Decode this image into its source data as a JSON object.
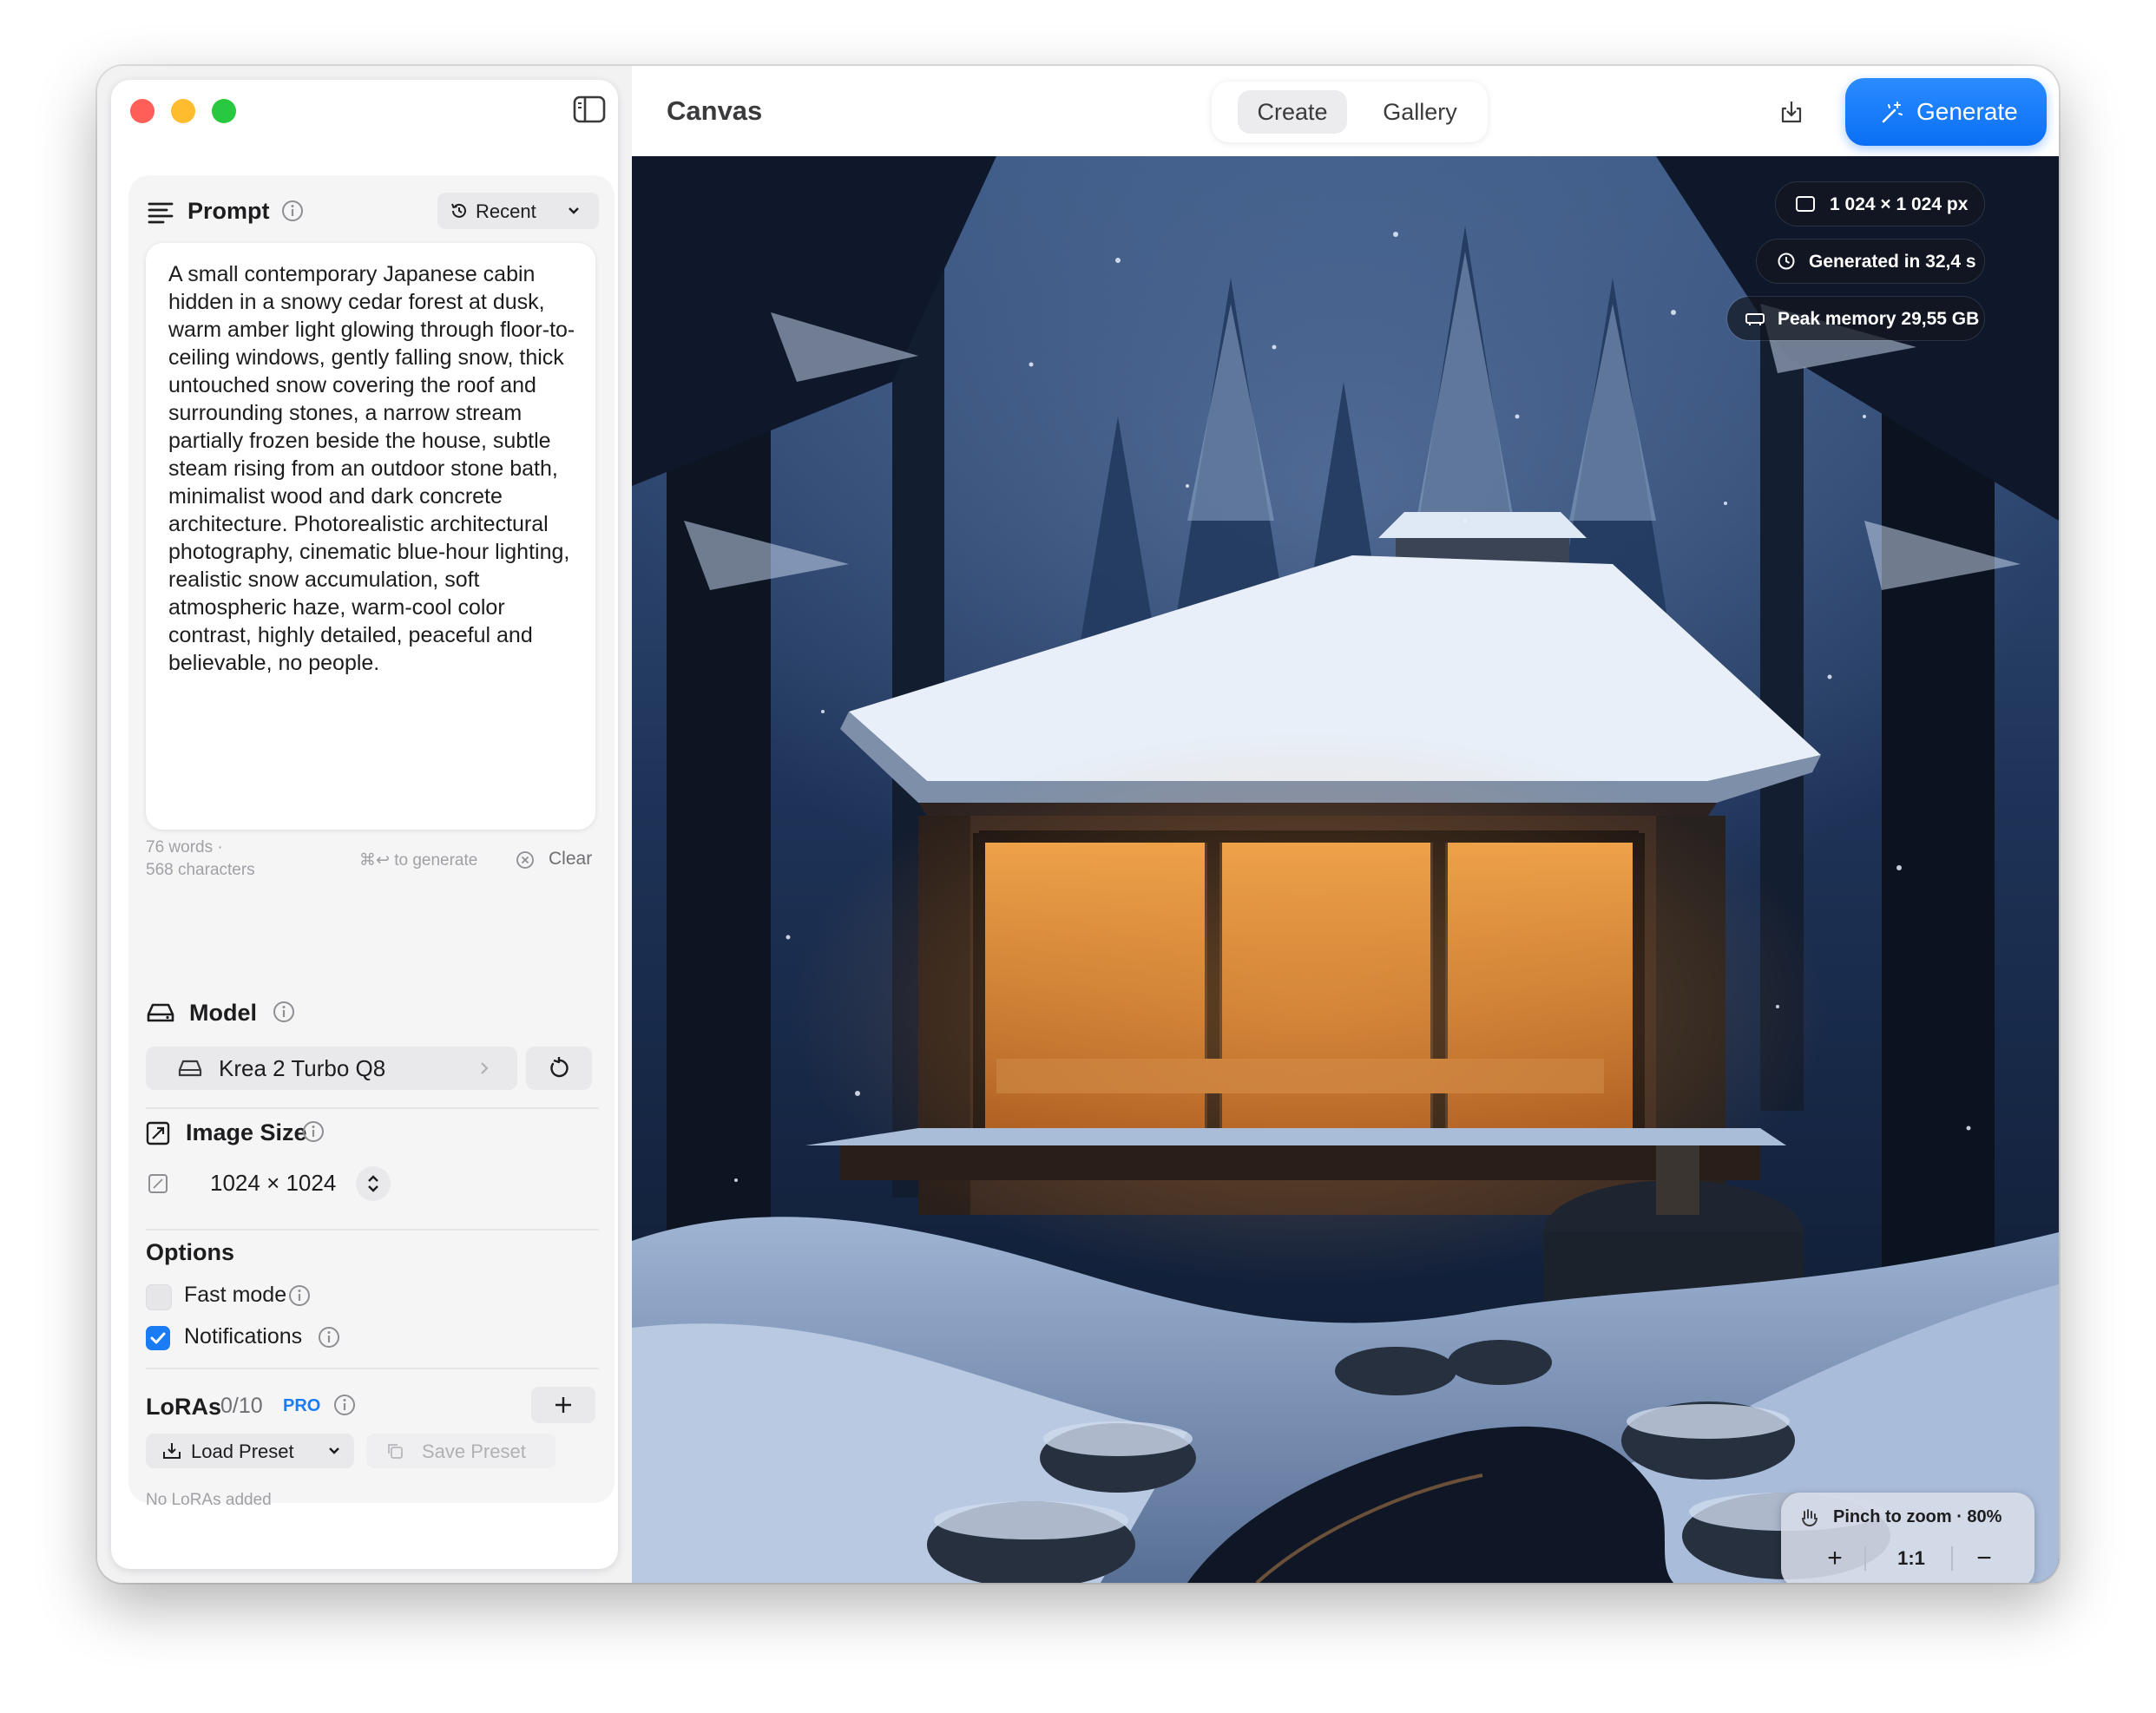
{
  "window": {
    "title": "Canvas"
  },
  "toolbar": {
    "tabs": [
      {
        "label": "Create",
        "selected": true
      },
      {
        "label": "Gallery",
        "selected": false
      }
    ],
    "generate_label": "Generate",
    "accent_color": "#0a6ff5"
  },
  "prompt": {
    "title": "Prompt",
    "recent_label": "Recent",
    "text": "A small contemporary Japanese cabin hidden in a snowy cedar forest at dusk, warm amber light glowing through floor-to-ceiling windows, gently falling snow, thick untouched snow covering the roof and surrounding stones, a narrow stream partially frozen beside the house, subtle steam rising from an outdoor stone bath, minimalist wood and dark concrete architecture. Photorealistic architectural photography, cinematic blue-hour lighting, realistic snow accumulation, soft atmospheric haze, warm-cool color contrast, highly detailed, peaceful and believable, no people.",
    "words": "76 words ·",
    "characters": "568 characters",
    "shortcut": "⌘↩ to generate",
    "clear_label": "Clear"
  },
  "model": {
    "title": "Model",
    "selected": "Krea 2 Turbo Q8"
  },
  "image_size": {
    "title": "Image Size",
    "value": "1024 × 1024"
  },
  "options": {
    "title": "Options",
    "items": [
      {
        "label": "Fast mode",
        "checked": false
      },
      {
        "label": "Notifications",
        "checked": true
      }
    ]
  },
  "loras": {
    "title": "LoRAs",
    "count": "0/10",
    "badge": "PRO",
    "load_preset": "Load Preset",
    "save_preset": "Save Preset",
    "empty": "No LoRAs added"
  },
  "canvas": {
    "badges": {
      "size": "1 024 × 1 024 px",
      "time": "Generated in 32,4 s",
      "memory": "Peak memory 29,55 GB"
    },
    "zoom": {
      "hint": "Pinch to zoom · 80%",
      "plus": "+",
      "reset": "1:1",
      "minus": "−"
    }
  }
}
